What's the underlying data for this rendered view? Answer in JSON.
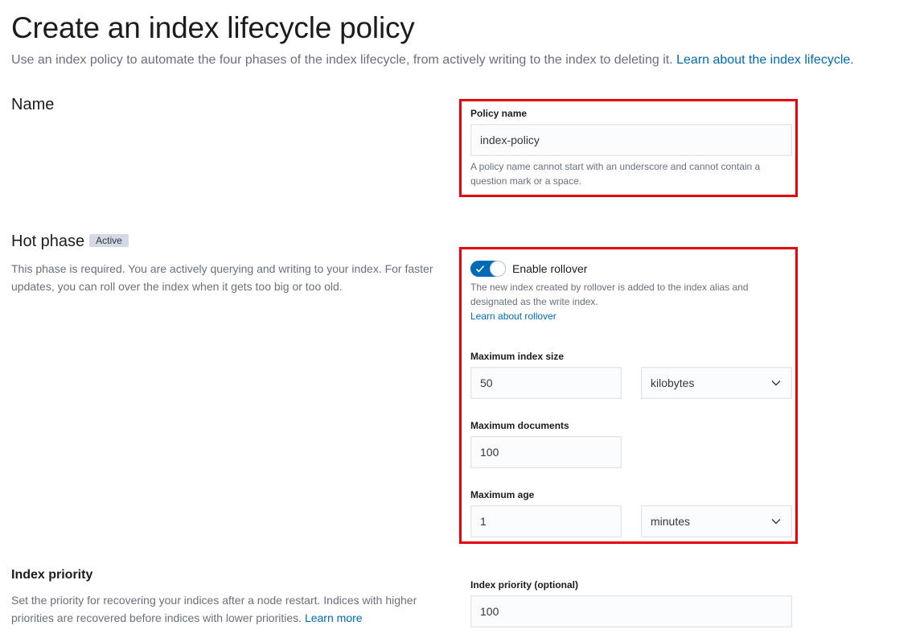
{
  "page": {
    "title": "Create an index lifecycle policy",
    "subtitle": "Use an index policy to automate the four phases of the index lifecycle, from actively writing to the index to deleting it.",
    "subtitle_link": "Learn about the index lifecycle."
  },
  "name_section": {
    "title": "Name",
    "field_label": "Policy name",
    "field_value": "index-policy",
    "help_text": "A policy name cannot start with an underscore and cannot contain a question mark or a space."
  },
  "hot_phase": {
    "title": "Hot phase",
    "badge": "Active",
    "description": "This phase is required. You are actively querying and writing to your index. For faster updates, you can roll over the index when it gets too big or too old.",
    "rollover_toggle_label": "Enable rollover",
    "rollover_enabled": true,
    "rollover_help": "The new index created by rollover is added to the index alias and designated as the write index.",
    "rollover_link": "Learn about rollover",
    "max_size_label": "Maximum index size",
    "max_size_value": "50",
    "max_size_unit": "kilobytes",
    "max_docs_label": "Maximum documents",
    "max_docs_value": "100",
    "max_age_label": "Maximum age",
    "max_age_value": "1",
    "max_age_unit": "minutes"
  },
  "index_priority": {
    "title": "Index priority",
    "description": "Set the priority for recovering your indices after a node restart. Indices with higher priorities are recovered before indices with lower priorities.",
    "description_link": "Learn more",
    "field_label": "Index priority (optional)",
    "field_value": "100"
  },
  "colors": {
    "accent": "#006bb4",
    "highlight_border": "#e7000d",
    "badge_bg": "#d3dae6"
  },
  "icons": [
    "check-icon",
    "chevron-down-icon"
  ]
}
